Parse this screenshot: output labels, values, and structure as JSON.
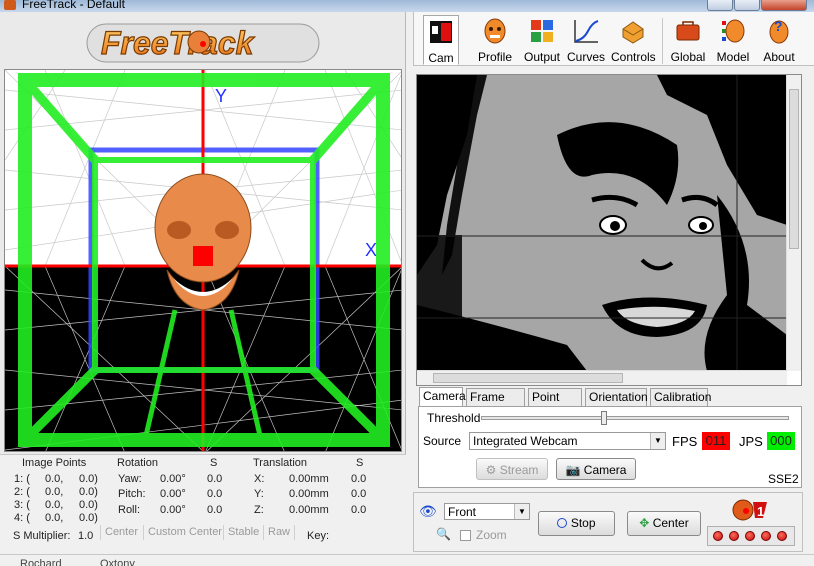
{
  "window": {
    "title": "FreeTrack - Default"
  },
  "logo": {
    "text": "FreeTrack"
  },
  "axes": {
    "y_label": "Y",
    "x_label": "X"
  },
  "toolbar": {
    "items": [
      {
        "label": "Cam",
        "icon": "cam-icon",
        "active": true
      },
      {
        "label": "Profile",
        "icon": "profile-icon"
      },
      {
        "label": "Output",
        "icon": "output-icon"
      },
      {
        "label": "Curves",
        "icon": "curves-icon"
      },
      {
        "label": "Controls",
        "icon": "controls-icon"
      },
      {
        "label": "Global",
        "icon": "global-icon"
      },
      {
        "label": "Model",
        "icon": "model-icon"
      },
      {
        "label": "About",
        "icon": "about-icon"
      }
    ]
  },
  "stats": {
    "image_points_header": "Image Points",
    "rotation_header": "Rotation",
    "s_header": "S",
    "translation_header": "Translation",
    "points": [
      {
        "label": "1: (",
        "x": "0.0,",
        "y": "0.0)"
      },
      {
        "label": "2: (",
        "x": "0.0,",
        "y": "0.0)"
      },
      {
        "label": "3: (",
        "x": "0.0,",
        "y": "0.0)"
      },
      {
        "label": "4: (",
        "x": "0.0,",
        "y": "0.0)"
      }
    ],
    "rotation": [
      {
        "label": "Yaw:",
        "value": "0.00°",
        "s": "0.0"
      },
      {
        "label": "Pitch:",
        "value": "0.00°",
        "s": "0.0"
      },
      {
        "label": "Roll:",
        "value": "0.00°",
        "s": "0.0"
      }
    ],
    "translation": [
      {
        "label": "X:",
        "value": "0.00mm",
        "s": "0.0"
      },
      {
        "label": "Y:",
        "value": "0.00mm",
        "s": "0.0"
      },
      {
        "label": "Z:",
        "value": "0.00mm",
        "s": "0.0"
      }
    ],
    "s_multiplier_label": "S Multiplier:",
    "s_multiplier_value": "1.0",
    "buttons": [
      "Center",
      "Custom Center",
      "Stable",
      "Raw"
    ],
    "key_label": "Key:"
  },
  "camera_tabs": [
    "Camera",
    "Frame rate",
    "Point size",
    "Orientation",
    "Calibration"
  ],
  "camera_panel": {
    "threshold_label": "Threshold",
    "threshold_level": 0.4,
    "source_label": "Source",
    "source_value": "Integrated Webcam",
    "fps_label": "FPS",
    "fps_value": "011",
    "jps_label": "JPS",
    "jps_value": "000",
    "stream_label": "Stream",
    "camera_button": "Camera",
    "sse_label": "SSE2"
  },
  "controls": {
    "view_value": "Front",
    "zoom_label": "Zoom",
    "stop_label": "Stop",
    "center_label": "Center"
  },
  "colors": {
    "fps_bg": "#ff0000",
    "jps_bg": "#00ee00",
    "box_green": "#22ee22",
    "axis_red": "#ff0000",
    "axis_blue": "#2233ff",
    "skull": "#e88a4a"
  },
  "statusbar": {
    "left": "Rochard",
    "mid": "Oxtony"
  }
}
